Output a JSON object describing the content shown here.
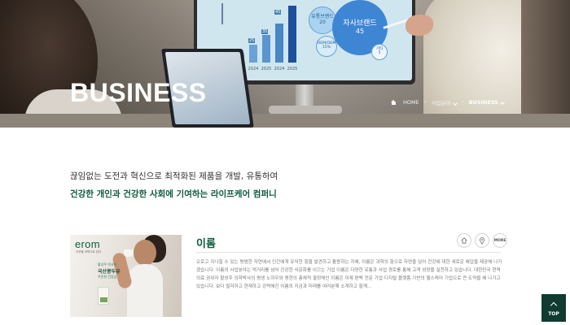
{
  "hero": {
    "title": "BUSINESS",
    "breadcrumb": {
      "home": "HOME",
      "level1": "사업분야",
      "level2": "BUSINESS"
    },
    "screen_chart": {
      "years": [
        "2023",
        "2024",
        "2025",
        "2024",
        "2025"
      ],
      "values": [
        "15",
        "25",
        "35",
        "45",
        "45"
      ],
      "bubbles": [
        "자사브랜드",
        "45",
        "유통브랜드",
        "20",
        "OEM/ODM",
        "15%",
        "기타",
        "5"
      ]
    }
  },
  "intro": {
    "line1": "끊임없는 도전과 혁신으로 최적화된 제품을 개발, 유통하여",
    "line2": "건강한 개인과 건강한 사회에 기여하는 라이프케어 컴퍼니"
  },
  "card": {
    "title": "이롬",
    "more": "MORE",
    "description": "오로고 지나칠 수 있는 평범한 자연에서 인간에게 유익한 힘을 발견하고 활용하는 지혜, 이롬은 과학의 힘으로 자연을 담아 건강에 대한 새로운 해답을 제공해 나가겠습니다. 이롬의 사업분야는 먹거리를 넘어 건강한 식문화를 이끄는 기업 이롬은 다양한 유통과 사업 경로를 통해 고객 성장을 실천하고 있습니다. 대한민국 현역 의료 권위자 황성주 의학박사의 평생 노하우와 명현의 총체적 결정체인 이롬은 이제 편백 전문 기업 디지털 플랫폼 기반의 헬스케어 기업으로 큰 도약을 해 나가고 있습니다. 보다 철저하고 현재하고 강력해진 이롬의 지금과 미래를 여러분께 소개하고 할께…",
    "image": {
      "logo": "erom",
      "logo_sub": "자연을 과학으로 담다",
      "promo_line1": "황성주 박사의",
      "promo_line2": "국산콩두유",
      "promo_line3": "꾸준한 건강습",
      "icon_home": "home-icon",
      "icon_location": "location-pin-icon"
    }
  },
  "top_button": {
    "label": "TOP"
  },
  "colors": {
    "brand_green": "#0e5c3f",
    "top_bg": "#0f3b30"
  }
}
